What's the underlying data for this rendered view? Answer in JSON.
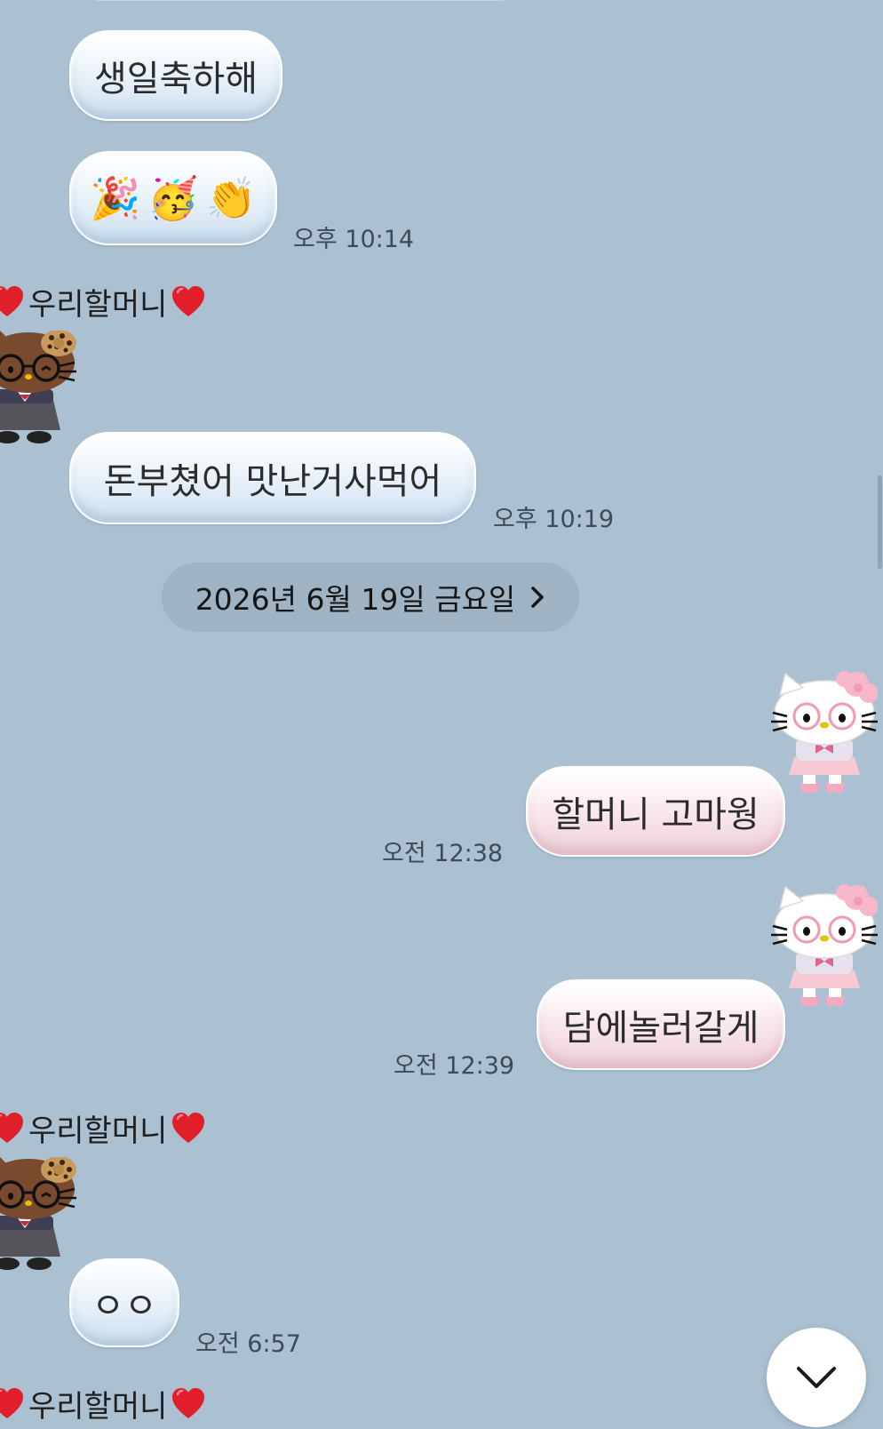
{
  "messages": {
    "m1": "생일축하해",
    "m2_emojis": [
      "🎉",
      "🥳",
      "👏"
    ],
    "m2_time": "오후 10:14",
    "m3": "돈부쳤어  맛난거사먹어",
    "m3_time": "오후 10:19",
    "m4": "할머니 고마웡",
    "m4_time": "오전 12:38",
    "m5": "담에놀러갈게",
    "m5_time": "오전 12:39",
    "m6": "ㅇㅇ",
    "m6_time": "오전 6:57"
  },
  "sender": {
    "name": "우리할머니"
  },
  "date_divider": "2026년 6월 19일 금요일",
  "icons": {
    "heart": "heart-icon",
    "chevron_right": "chevron-right-icon",
    "scroll_down": "chevron-down-icon",
    "sender_avatar": "brown-kitty-avatar",
    "my_avatar": "hello-kitty-avatar"
  },
  "colors": {
    "background": "#abc1d1",
    "incoming_bubble": "#e3eef8",
    "outgoing_bubble": "#f6e2e7",
    "heart": "#e01f2b"
  }
}
